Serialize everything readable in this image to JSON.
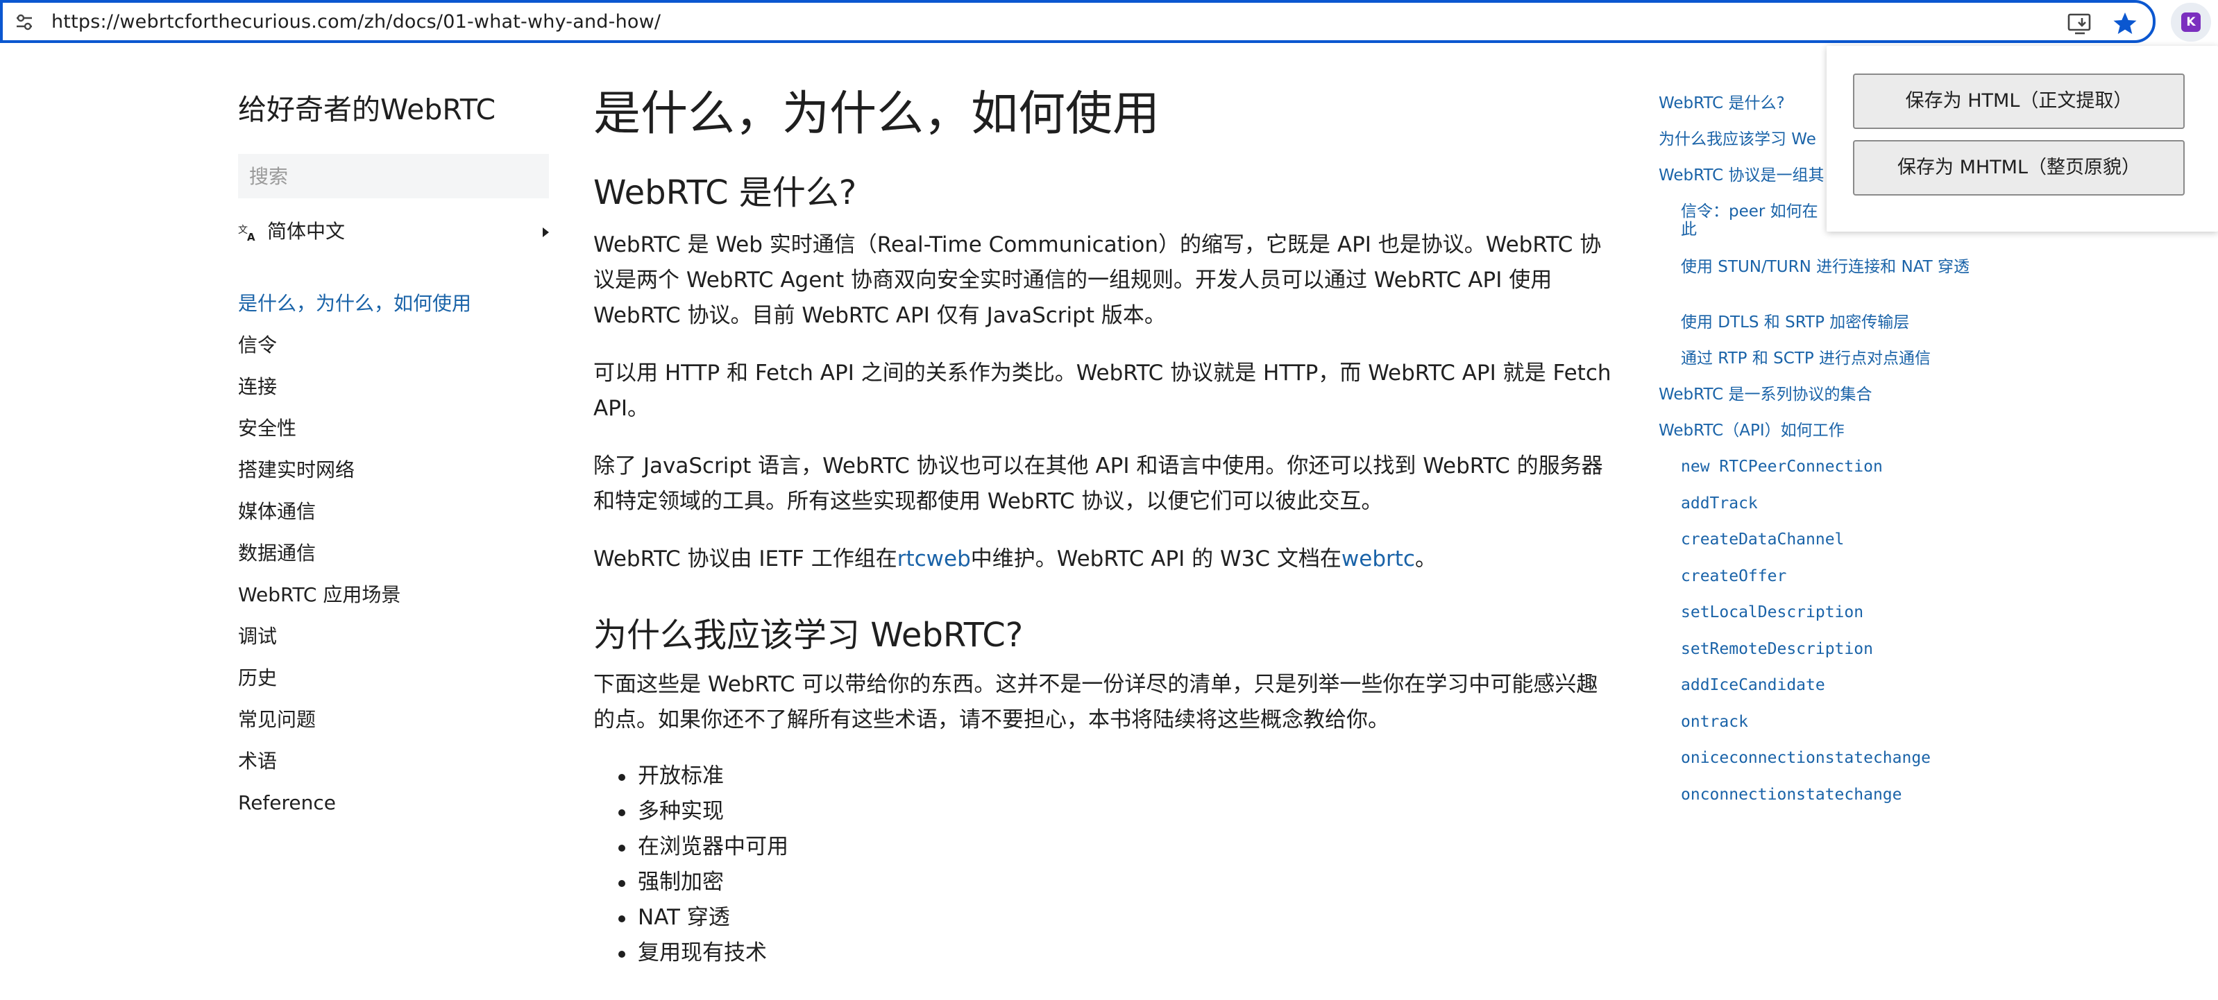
{
  "browser": {
    "url": "https://webrtcforthecurious.com/zh/docs/01-what-why-and-how/",
    "extension_icon_letter": "K",
    "accent": "#0b57d0"
  },
  "sidebar": {
    "site_title": "给好奇者的WebRTC",
    "search_placeholder": "搜索",
    "language": "简体中文",
    "items": [
      {
        "label": "是什么，为什么，如何使用",
        "active": true
      },
      {
        "label": "信令"
      },
      {
        "label": "连接"
      },
      {
        "label": "安全性"
      },
      {
        "label": "搭建实时网络"
      },
      {
        "label": "媒体通信"
      },
      {
        "label": "数据通信"
      },
      {
        "label": "WebRTC 应用场景"
      },
      {
        "label": "调试"
      },
      {
        "label": "历史"
      },
      {
        "label": "常见问题"
      },
      {
        "label": "术语"
      },
      {
        "label": "Reference"
      }
    ]
  },
  "main": {
    "title": "是什么，为什么，如何使用",
    "section1": {
      "heading": "WebRTC 是什么?",
      "p1": "WebRTC 是 Web 实时通信（Real-Time Communication）的缩写，它既是 API 也是协议。WebRTC 协议是两个 WebRTC Agent 协商双向安全实时通信的一组规则。开发人员可以通过 WebRTC API 使用 WebRTC 协议。目前 WebRTC API 仅有 JavaScript 版本。",
      "p2": "可以用 HTTP 和 Fetch API 之间的关系作为类比。WebRTC 协议就是 HTTP，而 WebRTC API 就是 Fetch API。",
      "p3": "除了 JavaScript 语言，WebRTC 协议也可以在其他 API 和语言中使用。你还可以找到 WebRTC 的服务器和特定领域的工具。所有这些实现都使用 WebRTC 协议，以便它们可以彼此交互。",
      "p4_before": "WebRTC 协议由 IETF 工作组在",
      "p4_link1": "rtcweb",
      "p4_middle": "中维护。WebRTC API 的 W3C 文档在",
      "p4_link2": "webrtc",
      "p4_after": "。"
    },
    "section2": {
      "heading": "为什么我应该学习 WebRTC?",
      "p1": "下面这些是 WebRTC 可以带给你的东西。这并不是一份详尽的清单，只是列举一些你在学习中可能感兴趣的点。如果你还不了解所有这些术语，请不要担心，本书将陆续将这些概念教给你。",
      "bullets": [
        "开放标准",
        "多种实现",
        "在浏览器中可用",
        "强制加密",
        "NAT 穿透",
        "复用现有技术"
      ]
    }
  },
  "toc": {
    "items": [
      "WebRTC 是什么?",
      "为什么我应该学习 We",
      "WebRTC 协议是一组其",
      "信令：peer 如何在",
      "此",
      "使用 STUN/TURN 进行连接和 NAT 穿透",
      "使用 DTLS 和 SRTP 加密传输层",
      "通过 RTP 和 SCTP 进行点对点通信",
      "WebRTC 是一系列协议的集合",
      "WebRTC（API）如何工作",
      "new RTCPeerConnection",
      "addTrack",
      "createDataChannel",
      "createOffer",
      "setLocalDescription",
      "setRemoteDescription",
      "addIceCandidate",
      "ontrack",
      "oniceconnectionstatechange",
      "onconnectionstatechange"
    ]
  },
  "popup": {
    "btn_html": "保存为 HTML（正文提取）",
    "btn_mhtml": "保存为 MHTML（整页原貌）"
  }
}
